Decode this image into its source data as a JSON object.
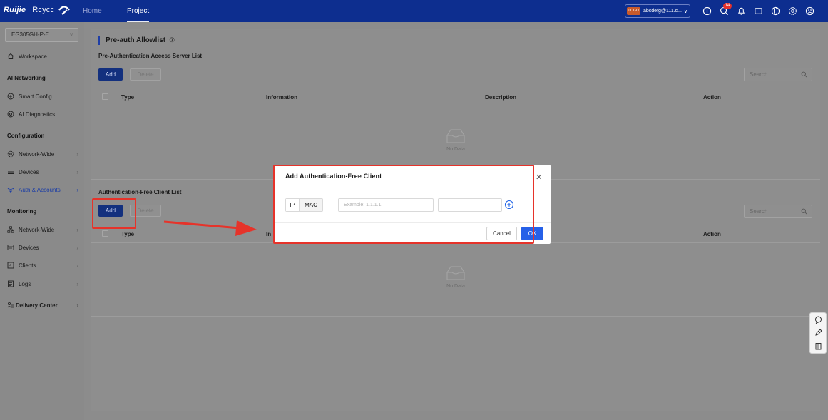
{
  "topbar": {
    "logo_brand": "Ruijie",
    "logo_separator": "|",
    "logo_sub": "Rcycc",
    "nav_home": "Home",
    "nav_project": "Project",
    "account_avatar": "LOGO",
    "account_email": "abcdefg@111.c...",
    "notification_count": "14"
  },
  "sidebar": {
    "device": "EG305GH-P-E",
    "workspace": "Workspace",
    "group_ai": "AI Networking",
    "smart_config": "Smart Config",
    "ai_diagnostics": "AI Diagnostics",
    "group_config": "Configuration",
    "config_network_wide": "Network-Wide",
    "config_devices": "Devices",
    "auth_accounts": "Auth & Accounts",
    "group_monitoring": "Monitoring",
    "mon_network_wide": "Network-Wide",
    "mon_devices": "Devices",
    "mon_clients": "Clients",
    "mon_logs": "Logs",
    "delivery_center": "Delivery Center"
  },
  "main": {
    "title": "Pre-auth Allowlist",
    "section1": {
      "title": "Pre-Authentication Access Server List",
      "add": "Add",
      "delete": "Delete",
      "search_placeholder": "Search",
      "columns": [
        "Type",
        "Information",
        "Description",
        "Action"
      ],
      "empty": "No Data"
    },
    "section2": {
      "title": "Authentication-Free Client List",
      "add": "Add",
      "delete": "Delete",
      "search_placeholder": "Search",
      "columns": [
        "Type",
        "In",
        "Action"
      ],
      "empty": "No Data"
    }
  },
  "modal": {
    "title": "Add Authentication-Free Client",
    "seg_ip": "IP",
    "seg_mac": "MAC",
    "ip_placeholder": "Example: 1.1.1.1",
    "cancel": "Cancel",
    "ok": "OK"
  },
  "colors": {
    "topbar": "#0d2e8f",
    "primary": "#2660e8",
    "annotation": "#e6332a"
  }
}
